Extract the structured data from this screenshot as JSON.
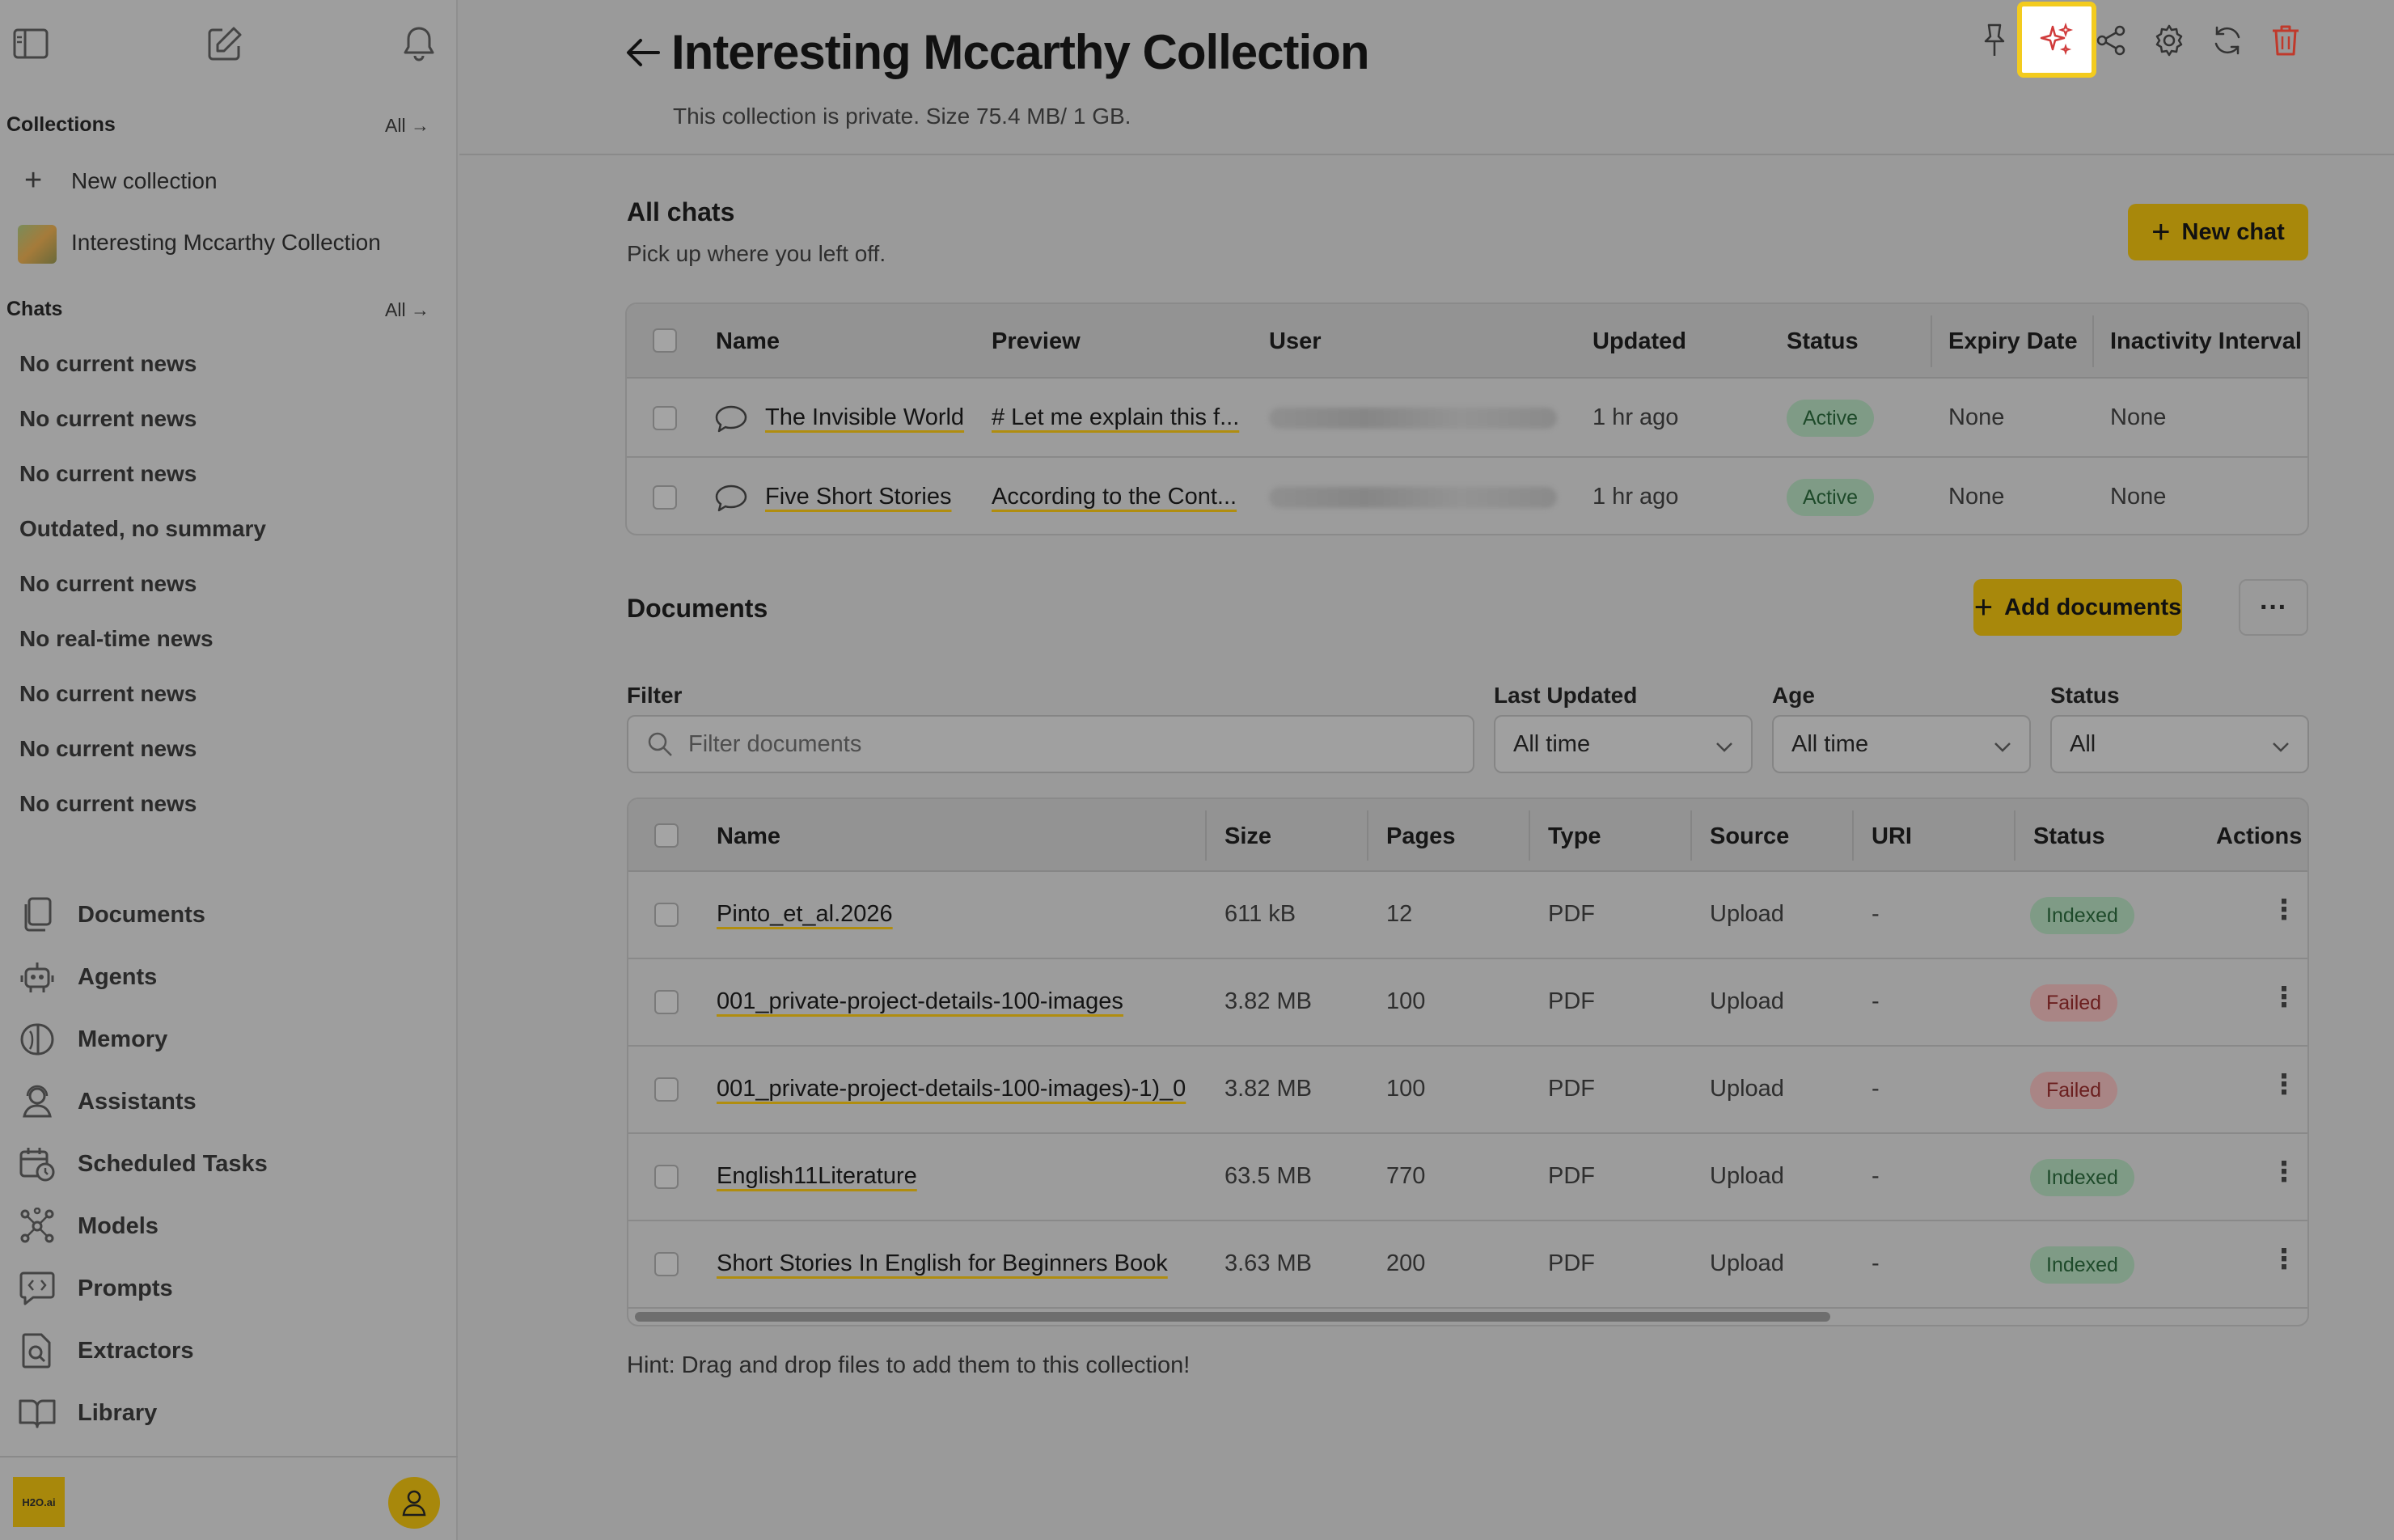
{
  "sidebar": {
    "collections_heading": "Collections",
    "collections_all": "All →",
    "new_collection": "New collection",
    "collection_item": "Interesting Mccarthy Collection",
    "chats_heading": "Chats",
    "chats_all": "All →",
    "chats": [
      "No current news",
      "No current news",
      "No current news",
      "Outdated, no summary",
      "No current news",
      "No real-time news",
      "No current news",
      "No current news",
      "No current news"
    ],
    "nav": [
      {
        "label": "Documents",
        "icon": "documents-icon"
      },
      {
        "label": "Agents",
        "icon": "robot-icon"
      },
      {
        "label": "Memory",
        "icon": "brain-icon"
      },
      {
        "label": "Assistants",
        "icon": "assistant-icon"
      },
      {
        "label": "Scheduled Tasks",
        "icon": "calendar-clock-icon"
      },
      {
        "label": "Models",
        "icon": "network-icon"
      },
      {
        "label": "Prompts",
        "icon": "code-bubble-icon"
      },
      {
        "label": "Extractors",
        "icon": "file-search-icon"
      },
      {
        "label": "Library",
        "icon": "book-icon"
      }
    ],
    "logo_text": "H2O.ai"
  },
  "header": {
    "title": "Interesting Mccarthy Collection",
    "subtitle": "This collection is private. Size 75.4 MB/ 1 GB."
  },
  "chats_section": {
    "title": "All chats",
    "subtitle": "Pick up where you left off.",
    "new_chat": "New chat",
    "columns": [
      "Name",
      "Preview",
      "User",
      "Updated",
      "Status",
      "Expiry Date",
      "Inactivity Interval"
    ],
    "rows": [
      {
        "name": "The Invisible World",
        "preview": "# Let me explain this f...",
        "updated": "1 hr ago",
        "status": "Active",
        "expiry": "None",
        "inactivity": "None"
      },
      {
        "name": "Five Short Stories",
        "preview": "According to the Cont...",
        "updated": "1 hr ago",
        "status": "Active",
        "expiry": "None",
        "inactivity": "None"
      }
    ]
  },
  "documents_section": {
    "title": "Documents",
    "add_documents": "Add documents",
    "more": "···",
    "filter_label": "Filter",
    "filter_placeholder": "Filter documents",
    "last_updated_label": "Last Updated",
    "last_updated_value": "All time",
    "age_label": "Age",
    "age_value": "All time",
    "status_label": "Status",
    "status_value": "All",
    "columns": [
      "Name",
      "Size",
      "Pages",
      "Type",
      "Source",
      "URI",
      "Status",
      "Actions"
    ],
    "rows": [
      {
        "name": "Pinto_et_al.2026",
        "size": "611 kB",
        "pages": "12",
        "type": "PDF",
        "source": "Upload",
        "uri": "-",
        "status": "Indexed"
      },
      {
        "name": "001_private-project-details-100-images",
        "size": "3.82 MB",
        "pages": "100",
        "type": "PDF",
        "source": "Upload",
        "uri": "-",
        "status": "Failed"
      },
      {
        "name": "001_private-project-details-100-images)-1)_0",
        "size": "3.82 MB",
        "pages": "100",
        "type": "PDF",
        "source": "Upload",
        "uri": "-",
        "status": "Failed"
      },
      {
        "name": "English11Literature",
        "size": "63.5 MB",
        "pages": "770",
        "type": "PDF",
        "source": "Upload",
        "uri": "-",
        "status": "Indexed"
      },
      {
        "name": "Short Stories In English for Beginners Book",
        "size": "3.63 MB",
        "pages": "200",
        "type": "PDF",
        "source": "Upload",
        "uri": "-",
        "status": "Indexed"
      }
    ],
    "hint": "Hint: Drag and drop files to add them to this collection!"
  },
  "colors": {
    "accent": "#a8880b",
    "highlight": "#f3cb1e",
    "danger": "#c0392b"
  }
}
